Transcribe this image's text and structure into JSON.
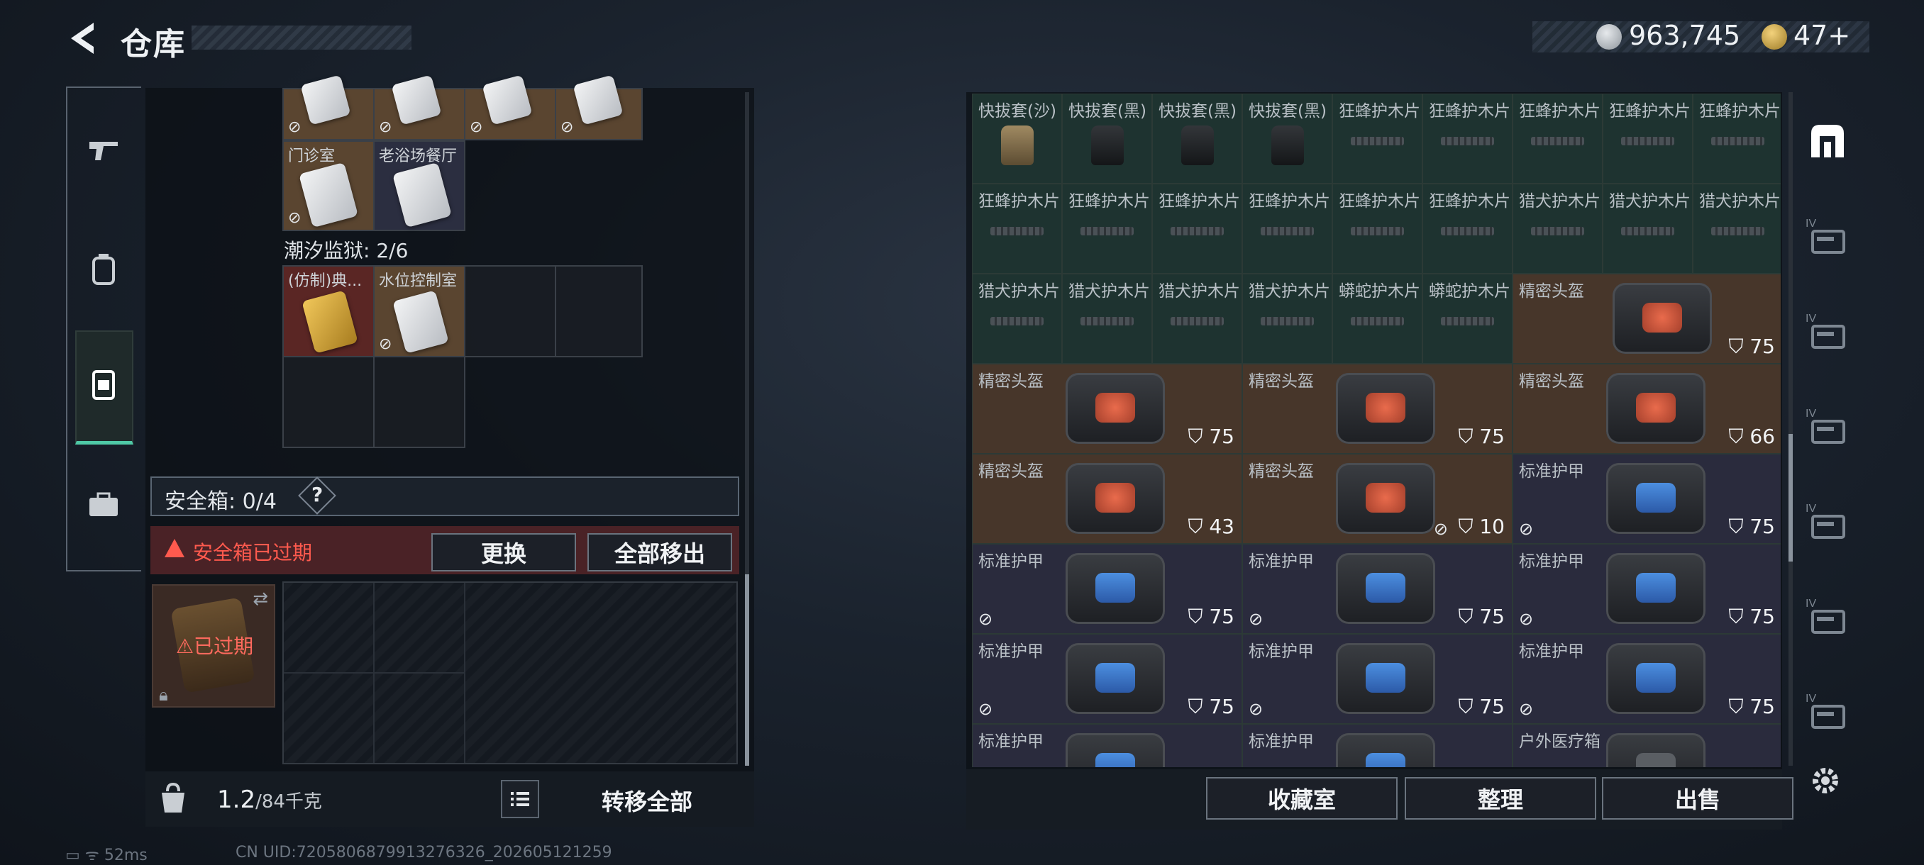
{
  "header": {
    "title": "仓库"
  },
  "currency": [
    {
      "icon": "silver-coin-icon",
      "value": "963,745"
    },
    {
      "icon": "gold-coin-icon",
      "value": "47+"
    }
  ],
  "left_nav": [
    {
      "icon": "gun-icon"
    },
    {
      "icon": "backpack-icon"
    },
    {
      "icon": "chest-rig-icon",
      "active": true
    },
    {
      "icon": "toolbox-icon"
    }
  ],
  "keycards_top": [
    "门诊室",
    "老浴场餐厅"
  ],
  "prison": {
    "label": "潮汐监狱: 2/6",
    "cards": [
      "(仿制)典...",
      "水位控制室"
    ]
  },
  "safebox": {
    "label": "安全箱: 0/4",
    "help": "?",
    "expired_text": "安全箱已过期",
    "replace_btn": "更换",
    "move_all_btn": "全部移出",
    "item_status": "已过期"
  },
  "bottom_left": {
    "weight": "1.2",
    "weight_max": "/84千克",
    "transfer_btn": "转移全部"
  },
  "status": {
    "ping": "52ms",
    "uid": "CN UID:7205806879913276326_202605121259"
  },
  "grid": {
    "row1": [
      "快拔套(沙)",
      "快拔套(黑)",
      "快拔套(黑)",
      "快拔套(黑)",
      "狂蜂护木片",
      "狂蜂护木片",
      "狂蜂护木片",
      "狂蜂护木片",
      "狂蜂护木片"
    ],
    "row2": [
      "狂蜂护木片",
      "狂蜂护木片",
      "狂蜂护木片",
      "狂蜂护木片",
      "狂蜂护木片",
      "狂蜂护木片",
      "猎犬护木片",
      "猎犬护木片",
      "猎犬护木片"
    ],
    "row3": [
      "猎犬护木片",
      "猎犬护木片",
      "猎犬护木片",
      "猎犬护木片",
      "蟒蛇护木片",
      "蟒蛇护木片"
    ],
    "big_items": [
      {
        "label": "精密头盔",
        "dur": "75"
      },
      {
        "label": "精密头盔",
        "dur": "75"
      },
      {
        "label": "精密头盔",
        "dur": "75"
      },
      {
        "label": "精密头盔",
        "dur": "66"
      },
      {
        "label": "精密头盔",
        "dur": "43"
      },
      {
        "label": "精密头盔",
        "dur": "10"
      },
      {
        "label": "标准护甲",
        "dur": "75"
      },
      {
        "label": "标准护甲",
        "dur": "75"
      },
      {
        "label": "标准护甲",
        "dur": "75"
      },
      {
        "label": "标准护甲",
        "dur": "75"
      },
      {
        "label": "标准护甲",
        "dur": "75"
      },
      {
        "label": "标准护甲",
        "dur": "75"
      },
      {
        "label": "标准护甲",
        "dur": "75"
      },
      {
        "label": "标准护甲",
        "dur": ""
      },
      {
        "label": "标准护甲",
        "dur": ""
      },
      {
        "label": "户外医疗箱",
        "dur": ""
      }
    ]
  },
  "bottom_right": {
    "collection_btn": "收藏室",
    "sort_btn": "整理",
    "sell_btn": "出售"
  },
  "right_nav": [
    {
      "icon": "storage-main-icon",
      "active": true
    },
    {
      "icon": "storage-iv-weapon-icon"
    },
    {
      "icon": "storage-iv-folder-icon"
    },
    {
      "icon": "storage-iv-folder2-icon"
    },
    {
      "icon": "storage-iv-lock-icon"
    },
    {
      "icon": "storage-iv-folder3-icon"
    },
    {
      "icon": "storage-iv-add-icon"
    }
  ]
}
